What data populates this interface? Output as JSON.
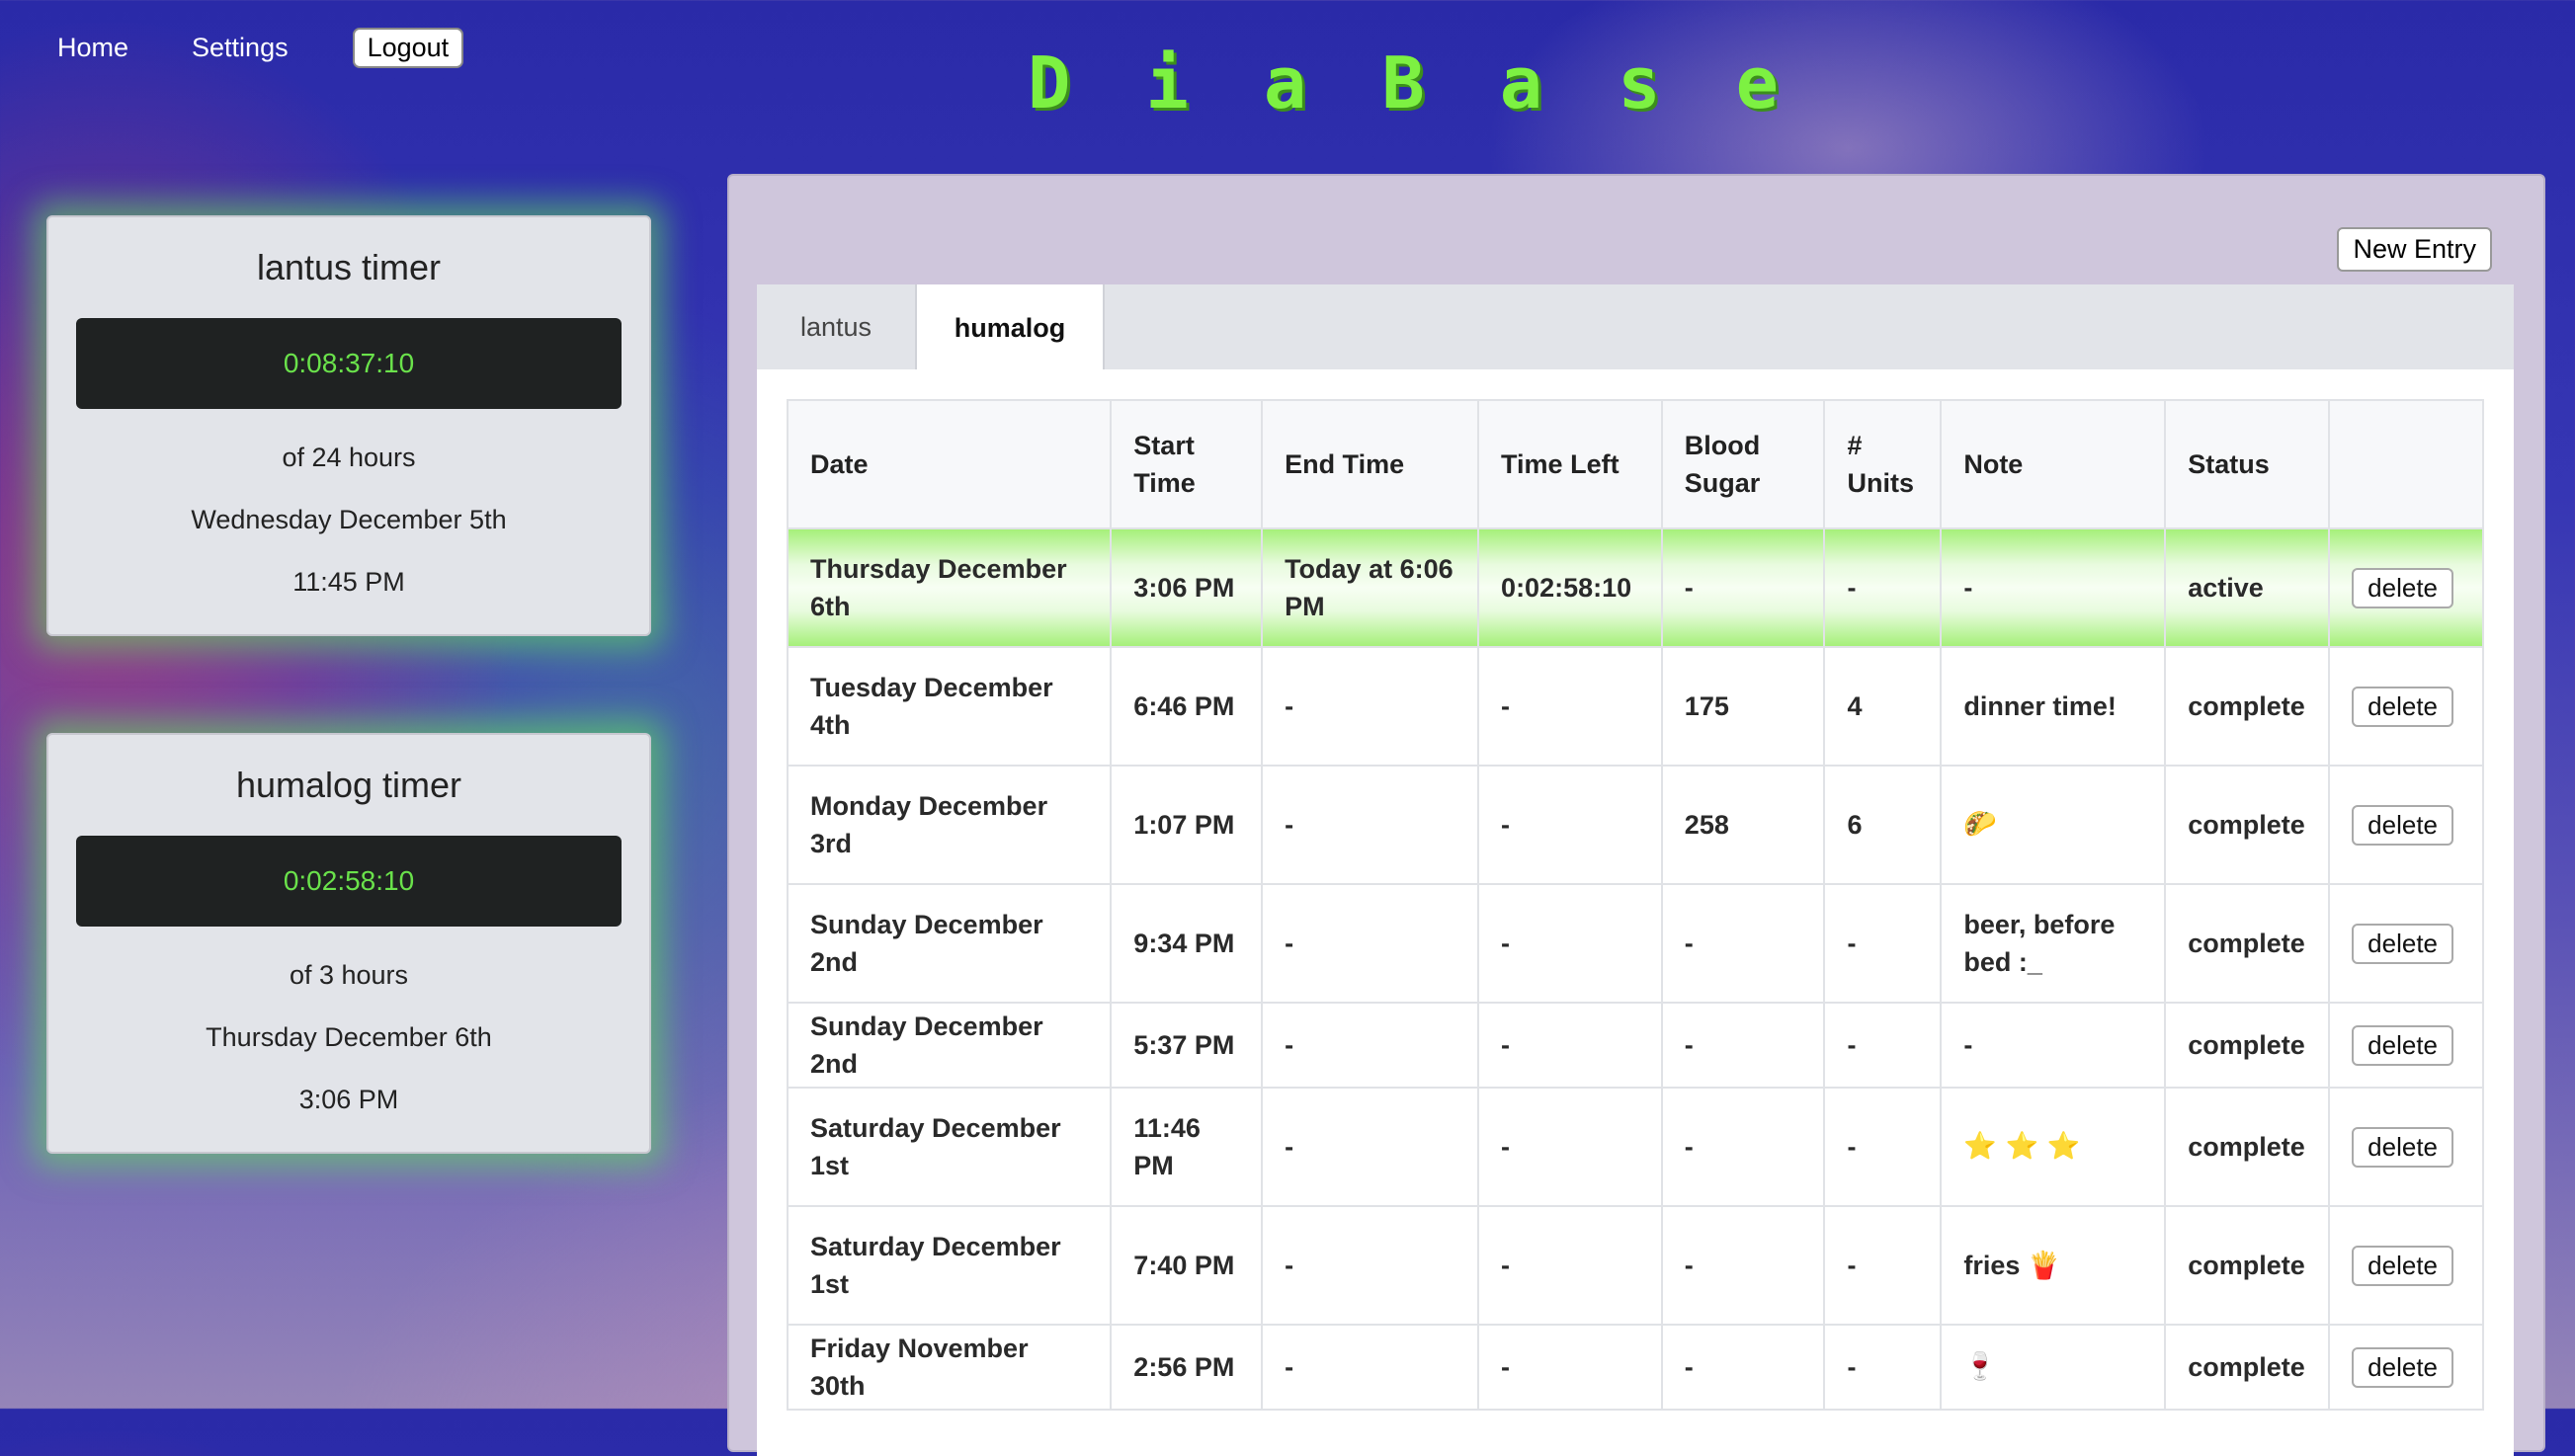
{
  "nav": {
    "home": "Home",
    "settings": "Settings",
    "logout": "Logout"
  },
  "logo_letters": [
    "D",
    "i",
    "a",
    "B",
    "a",
    "s",
    "e"
  ],
  "timers": [
    {
      "title": "lantus timer",
      "display": "0:08:37:10",
      "duration": "of 24 hours",
      "date": "Wednesday December 5th",
      "time": "11:45 PM"
    },
    {
      "title": "humalog timer",
      "display": "0:02:58:10",
      "duration": "of 3 hours",
      "date": "Thursday December 6th",
      "time": "3:06 PM"
    }
  ],
  "panel": {
    "new_entry": "New Entry"
  },
  "tabs": [
    {
      "label": "lantus",
      "active": false
    },
    {
      "label": "humalog",
      "active": true
    }
  ],
  "table": {
    "headers": [
      "Date",
      "Start Time",
      "End Time",
      "Time Left",
      "Blood Sugar",
      "# Units",
      "Note",
      "Status",
      ""
    ],
    "delete_label": "delete",
    "rows": [
      {
        "date": "Thursday December 6th",
        "start": "3:06 PM",
        "end": "Today at 6:06 PM",
        "left": "0:02:58:10",
        "sugar": "-",
        "units": "-",
        "note": "-",
        "status": "active",
        "active": true
      },
      {
        "date": "Tuesday December 4th",
        "start": "6:46 PM",
        "end": "-",
        "left": "-",
        "sugar": "175",
        "units": "4",
        "note": "dinner time!",
        "status": "complete"
      },
      {
        "date": "Monday December 3rd",
        "start": "1:07 PM",
        "end": "-",
        "left": "-",
        "sugar": "258",
        "units": "6",
        "note": "🌮",
        "status": "complete"
      },
      {
        "date": "Sunday December 2nd",
        "start": "9:34 PM",
        "end": "-",
        "left": "-",
        "sugar": "-",
        "units": "-",
        "note": "beer, before bed :_",
        "status": "complete"
      },
      {
        "date": "Sunday December 2nd",
        "start": "5:37 PM",
        "end": "-",
        "left": "-",
        "sugar": "-",
        "units": "-",
        "note": "-",
        "status": "complete"
      },
      {
        "date": "Saturday December 1st",
        "start": "11:46 PM",
        "end": "-",
        "left": "-",
        "sugar": "-",
        "units": "-",
        "note": "⭐ ⭐ ⭐",
        "status": "complete"
      },
      {
        "date": "Saturday December 1st",
        "start": "7:40 PM",
        "end": "-",
        "left": "-",
        "sugar": "-",
        "units": "-",
        "note": "fries 🍟",
        "status": "complete"
      },
      {
        "date": "Friday November 30th",
        "start": "2:56 PM",
        "end": "-",
        "left": "-",
        "sugar": "-",
        "units": "-",
        "note": "🍷",
        "status": "complete"
      }
    ]
  }
}
